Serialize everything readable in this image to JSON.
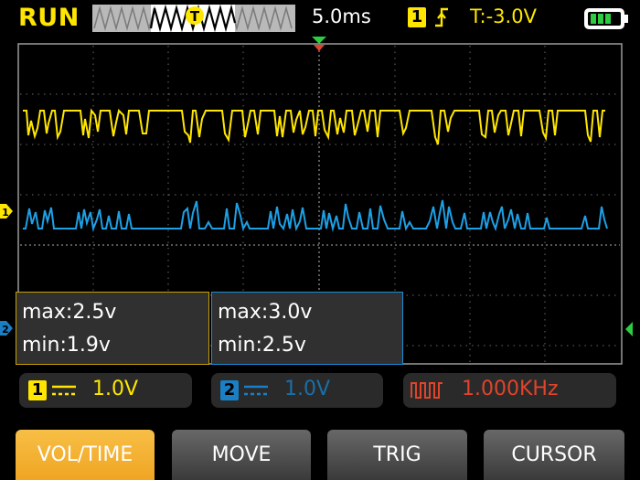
{
  "status": {
    "run_state": "RUN",
    "timebase": "5.0ms",
    "trigger_channel": "1",
    "trigger_level": "T:-3.0V",
    "trigger_marker": "T"
  },
  "markers": {
    "ch1": "1",
    "ch2": "2"
  },
  "measurements": [
    {
      "max": "max:2.5v",
      "min": "min:1.9v"
    },
    {
      "max": "max:3.0v",
      "min": "min:2.5v"
    }
  ],
  "channels": [
    {
      "badge": "1",
      "scale": "1.0V"
    },
    {
      "badge": "2",
      "scale": "1.0V"
    }
  ],
  "generator": {
    "freq": "1.000KHz"
  },
  "buttons": [
    "VOL/TIME",
    "MOVE",
    "TRIG",
    "CURSOR"
  ],
  "colors": {
    "ch1": "#ffe600",
    "ch2": "#1ea0e6",
    "accent": "#f2ac2c",
    "generator": "#e0442a"
  },
  "icons": [
    "rising-edge-icon",
    "battery-icon",
    "square-wave-icon"
  ]
}
